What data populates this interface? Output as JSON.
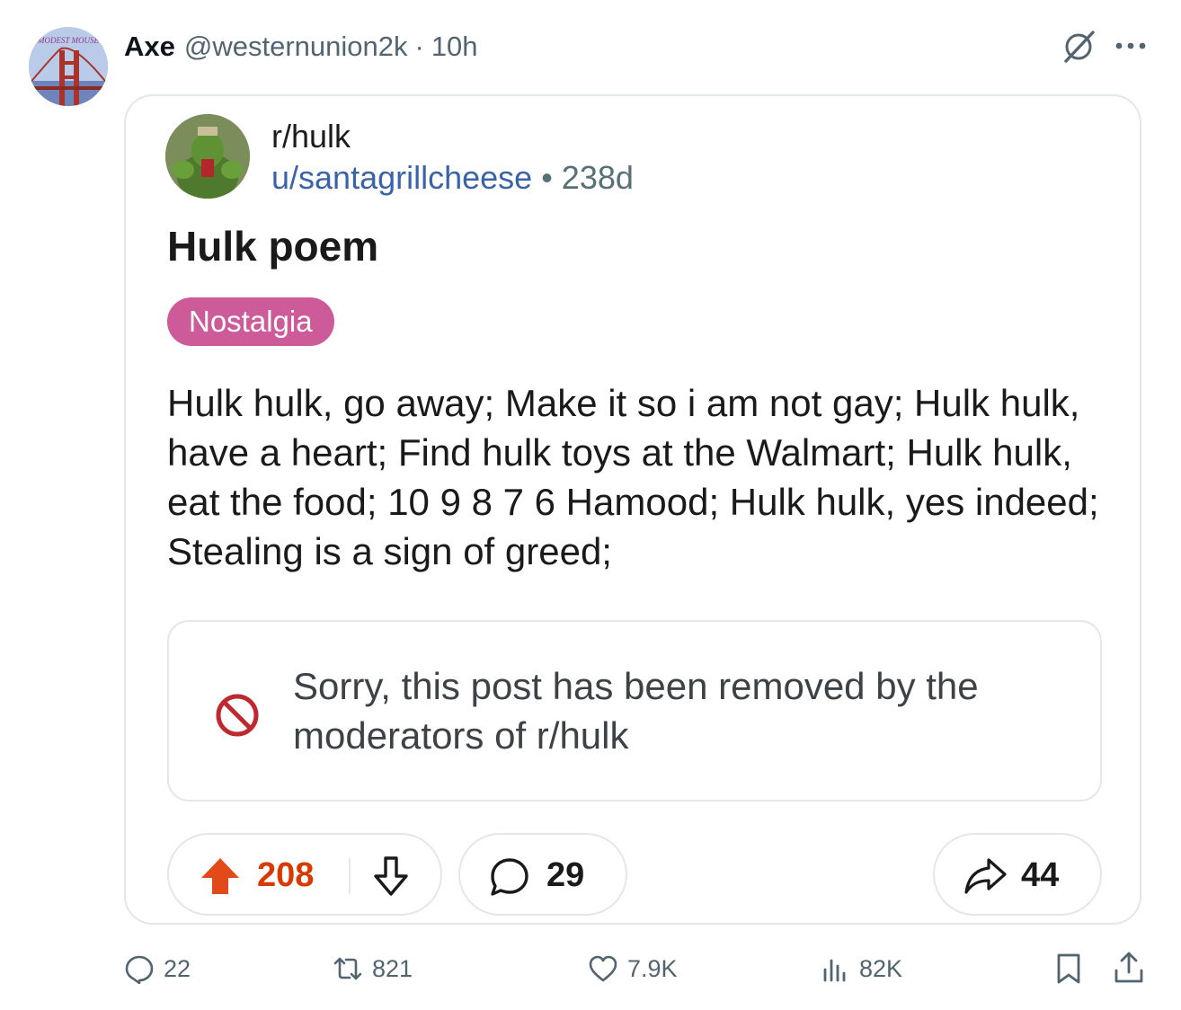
{
  "tweet": {
    "author_name": "Axe",
    "author_handle": "@westernunion2k",
    "separator": "·",
    "time": "10h",
    "avatar_text": "MODEST MOUSE"
  },
  "embed": {
    "subreddit": "r/hulk",
    "username": "u/santagrillcheese",
    "meta_separator": "•",
    "age": "238d",
    "title": "Hulk poem",
    "flair": "Nostalgia",
    "body": "Hulk hulk, go away; Make it so i am not gay; Hulk hulk, have a heart; Find hulk toys at the Walmart; Hulk hulk, eat the food; 10 9 8 7 6 Hamood; Hulk hulk, yes indeed; Stealing is a sign of greed;",
    "removed_notice": "Sorry, this post has been removed by the moderators of r/hulk",
    "upvotes": "208",
    "comments": "29",
    "shares": "44"
  },
  "actions": {
    "replies": "22",
    "reposts": "821",
    "likes": "7.9K",
    "views": "82K"
  },
  "icons": {
    "grok": "grok-slash-icon",
    "more": "more-dots-icon",
    "ban": "ban-icon",
    "upvote": "upvote-arrow-icon",
    "downvote": "downvote-arrow-icon",
    "comment": "comment-bubble-icon",
    "share": "share-arrow-icon",
    "reply": "reply-icon",
    "repost": "repost-icon",
    "like": "heart-icon",
    "views": "views-chart-icon",
    "bookmark": "bookmark-icon",
    "share_tweet": "share-upload-icon"
  },
  "colors": {
    "flair": "#cd5b9a",
    "upvote": "#d93900",
    "username_link": "#3a63a8",
    "ban_icon": "#c0282f",
    "muted": "#536471"
  }
}
